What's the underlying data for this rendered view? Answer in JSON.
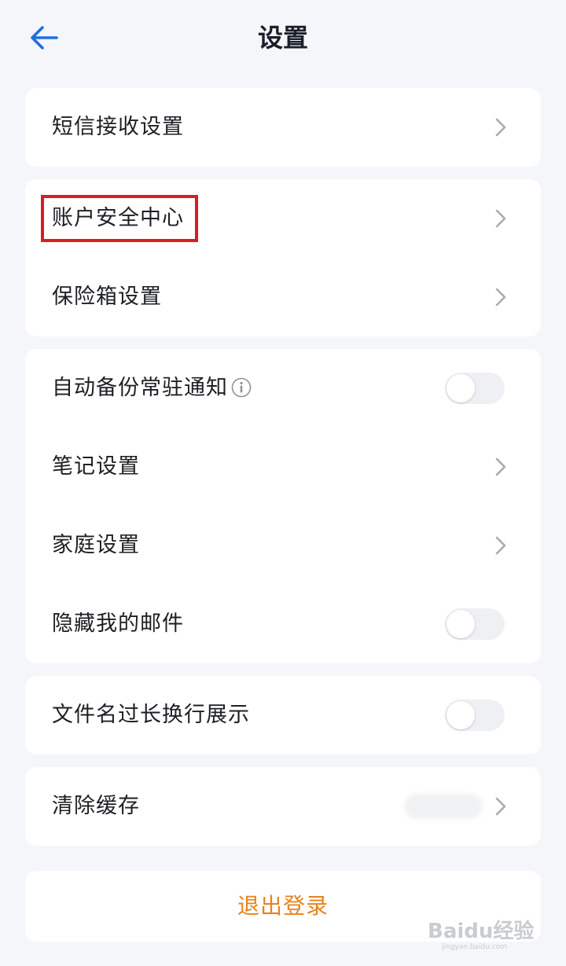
{
  "header": {
    "title": "设置"
  },
  "groups": [
    {
      "items": [
        {
          "label": "短信接收设置",
          "control": "chevron"
        }
      ]
    },
    {
      "items": [
        {
          "label": "账户安全中心",
          "control": "chevron",
          "highlighted": true
        },
        {
          "label": "保险箱设置",
          "control": "chevron"
        }
      ]
    },
    {
      "items": [
        {
          "label": "自动备份常驻通知",
          "control": "toggle",
          "toggle_on": false,
          "has_info_icon": true
        },
        {
          "label": "笔记设置",
          "control": "chevron"
        },
        {
          "label": "家庭设置",
          "control": "chevron"
        },
        {
          "label": "隐藏我的邮件",
          "control": "toggle",
          "toggle_on": false
        }
      ]
    },
    {
      "items": [
        {
          "label": "文件名过长换行展示",
          "control": "toggle",
          "toggle_on": false
        }
      ]
    },
    {
      "items": [
        {
          "label": "清除缓存",
          "control": "chevron",
          "value_blurred": true
        }
      ]
    }
  ],
  "logout": {
    "label": "退出登录"
  },
  "watermark": {
    "text": "Baidu经验",
    "sub": "jingyan.baidu.com"
  },
  "colors": {
    "accent": "#1f6fe0",
    "logout": "#e8821c",
    "highlight": "#d81e1e",
    "background": "#f4f6fa",
    "card": "#ffffff"
  },
  "icons": {
    "back": "arrow-left-icon",
    "chevron": "chevron-right-icon",
    "info": "info-circle-icon"
  }
}
